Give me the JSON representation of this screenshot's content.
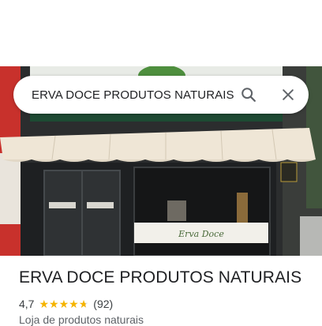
{
  "search": {
    "query": "ERVA DOCE PRODUTOS NATURAIS"
  },
  "icons": {
    "search": "search-icon",
    "close": "close-icon",
    "star": "star-icon"
  },
  "colors": {
    "star": "#f5b400",
    "awning": "#efe6d6",
    "sign_green": "#3f7d3a"
  },
  "photo": {
    "sign_text": "Erva Doce"
  },
  "place": {
    "name": "ERVA DOCE PRODUTOS NATURAIS",
    "rating": "4,7",
    "stars_value": 4.7,
    "review_count": "(92)",
    "category": "Loja de produtos naturais"
  }
}
